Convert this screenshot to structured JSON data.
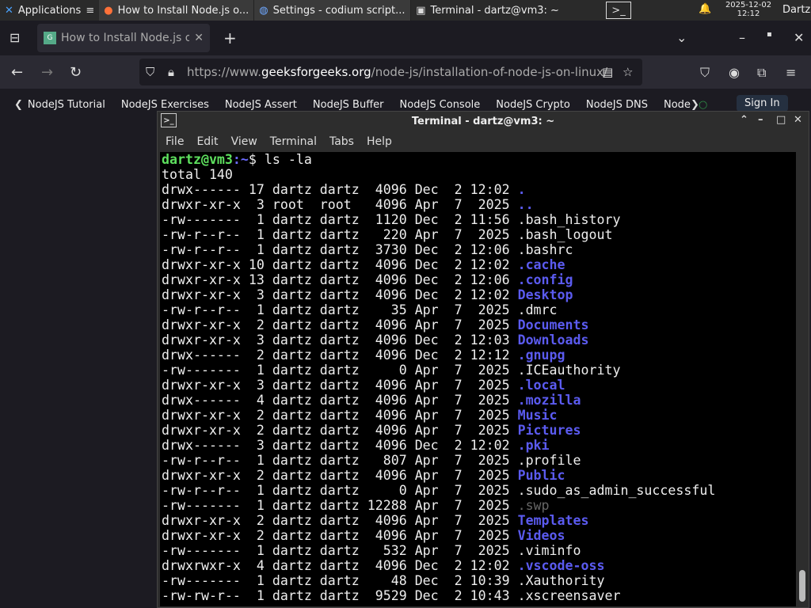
{
  "taskbar": {
    "apps_label": "Applications",
    "windows": [
      "How to Install Node.js o...",
      "Settings - codium script...",
      "Terminal - dartz@vm3: ~"
    ],
    "date": "2025-12-02",
    "time": "12:12",
    "user": "Dartz"
  },
  "browser": {
    "tab_title": "How to Install Node.js on",
    "url_prefix": "https://www.",
    "url_domain": "geeksforgeeks.org",
    "url_path": "/node-js/installation-of-node-js-on-linux/",
    "bookmarks": [
      "NodeJS Tutorial",
      "NodeJS Exercises",
      "NodeJS Assert",
      "NodeJS Buffer",
      "NodeJS Console",
      "NodeJS Crypto",
      "NodeJS DNS",
      "Node"
    ],
    "sign_in": "Sign In"
  },
  "terminal": {
    "title": "Terminal - dartz@vm3: ~",
    "menu": [
      "File",
      "Edit",
      "View",
      "Terminal",
      "Tabs",
      "Help"
    ],
    "prompt_user": "dartz@vm3",
    "prompt_path": ":~",
    "prompt_sym": "$ ",
    "command": "ls -la",
    "total": "total 140",
    "colors": {
      "directory": "#5b5bf0",
      "prompt": "#5ee05e"
    },
    "entries": [
      {
        "meta": "drwx------ 17 dartz dartz  4096 Dec  2 12:02 ",
        "name": ".",
        "type": "dir"
      },
      {
        "meta": "drwxr-xr-x  3 root  root   4096 Apr  7  2025 ",
        "name": "..",
        "type": "dir"
      },
      {
        "meta": "-rw-------  1 dartz dartz  1120 Dec  2 11:56 ",
        "name": ".bash_history",
        "type": "file"
      },
      {
        "meta": "-rw-r--r--  1 dartz dartz   220 Apr  7  2025 ",
        "name": ".bash_logout",
        "type": "file"
      },
      {
        "meta": "-rw-r--r--  1 dartz dartz  3730 Dec  2 12:06 ",
        "name": ".bashrc",
        "type": "file"
      },
      {
        "meta": "drwxr-xr-x 10 dartz dartz  4096 Dec  2 12:02 ",
        "name": ".cache",
        "type": "dir"
      },
      {
        "meta": "drwxr-xr-x 13 dartz dartz  4096 Dec  2 12:06 ",
        "name": ".config",
        "type": "dir"
      },
      {
        "meta": "drwxr-xr-x  3 dartz dartz  4096 Dec  2 12:02 ",
        "name": "Desktop",
        "type": "dir"
      },
      {
        "meta": "-rw-r--r--  1 dartz dartz    35 Apr  7  2025 ",
        "name": ".dmrc",
        "type": "file"
      },
      {
        "meta": "drwxr-xr-x  2 dartz dartz  4096 Apr  7  2025 ",
        "name": "Documents",
        "type": "dir"
      },
      {
        "meta": "drwxr-xr-x  3 dartz dartz  4096 Dec  2 12:03 ",
        "name": "Downloads",
        "type": "dir"
      },
      {
        "meta": "drwx------  2 dartz dartz  4096 Dec  2 12:12 ",
        "name": ".gnupg",
        "type": "dir"
      },
      {
        "meta": "-rw-------  1 dartz dartz     0 Apr  7  2025 ",
        "name": ".ICEauthority",
        "type": "file"
      },
      {
        "meta": "drwxr-xr-x  3 dartz dartz  4096 Apr  7  2025 ",
        "name": ".local",
        "type": "dir"
      },
      {
        "meta": "drwx------  4 dartz dartz  4096 Apr  7  2025 ",
        "name": ".mozilla",
        "type": "dir"
      },
      {
        "meta": "drwxr-xr-x  2 dartz dartz  4096 Apr  7  2025 ",
        "name": "Music",
        "type": "dir"
      },
      {
        "meta": "drwxr-xr-x  2 dartz dartz  4096 Apr  7  2025 ",
        "name": "Pictures",
        "type": "dir"
      },
      {
        "meta": "drwx------  3 dartz dartz  4096 Dec  2 12:02 ",
        "name": ".pki",
        "type": "dir"
      },
      {
        "meta": "-rw-r--r--  1 dartz dartz   807 Apr  7  2025 ",
        "name": ".profile",
        "type": "file"
      },
      {
        "meta": "drwxr-xr-x  2 dartz dartz  4096 Apr  7  2025 ",
        "name": "Public",
        "type": "dir"
      },
      {
        "meta": "-rw-r--r--  1 dartz dartz     0 Apr  7  2025 ",
        "name": ".sudo_as_admin_successful",
        "type": "file"
      },
      {
        "meta": "-rw-------  1 dartz dartz 12288 Apr  7  2025 ",
        "name": ".swp",
        "type": "dim"
      },
      {
        "meta": "drwxr-xr-x  2 dartz dartz  4096 Apr  7  2025 ",
        "name": "Templates",
        "type": "dir"
      },
      {
        "meta": "drwxr-xr-x  2 dartz dartz  4096 Apr  7  2025 ",
        "name": "Videos",
        "type": "dir"
      },
      {
        "meta": "-rw-------  1 dartz dartz   532 Apr  7  2025 ",
        "name": ".viminfo",
        "type": "file"
      },
      {
        "meta": "drwxrwxr-x  4 dartz dartz  4096 Dec  2 12:02 ",
        "name": ".vscode-oss",
        "type": "dir"
      },
      {
        "meta": "-rw-------  1 dartz dartz    48 Dec  2 10:39 ",
        "name": ".Xauthority",
        "type": "file"
      },
      {
        "meta": "-rw-rw-r--  1 dartz dartz  9529 Dec  2 10:43 ",
        "name": ".xscreensaver",
        "type": "file"
      }
    ]
  }
}
